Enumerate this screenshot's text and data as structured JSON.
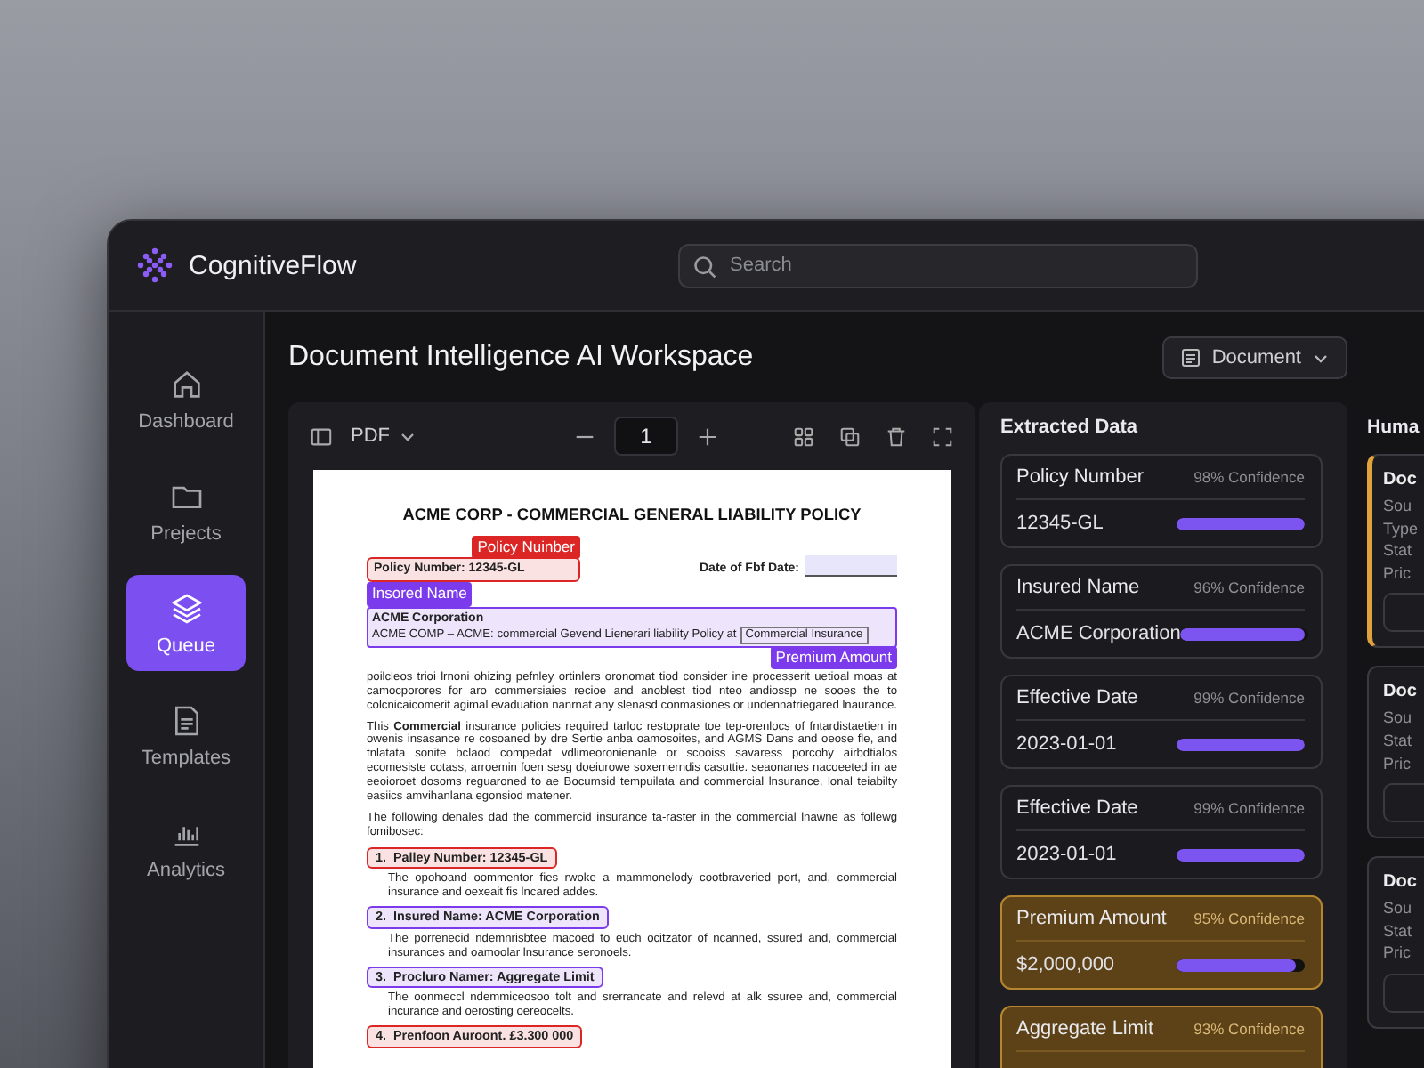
{
  "app": {
    "name": "CognitiveFlow"
  },
  "search": {
    "placeholder": "Search"
  },
  "sidebar": {
    "items": [
      {
        "label": "Dashboard",
        "selected": false
      },
      {
        "label": "Prejects",
        "selected": false
      },
      {
        "label": "Queue",
        "selected": true
      },
      {
        "label": "Templates",
        "selected": false
      },
      {
        "label": "Analytics",
        "selected": false
      }
    ]
  },
  "workspace": {
    "title": "Document Intelligence AI Workspace",
    "view_button": "Document"
  },
  "viewer": {
    "format": "PDF",
    "page": "1"
  },
  "document": {
    "title": "ACME CORP - COMMERCIAL GENERAL LIABILITY POLICY",
    "policy_field": {
      "tag": "Policy Nuinber",
      "text": "Policy Number: 12345-GL",
      "color": "#dc2626"
    },
    "date_label": "Date of Fbf Date:",
    "insured_block": {
      "tag": "Insored Name",
      "color": "#7c3aed",
      "heading": "ACME Corporation",
      "line": "ACME COMP – ACME: commercial Gevend Lienerari liability Policy at",
      "inline_box": "Commercial Insurance",
      "inline_tag": "Premium Amount"
    },
    "paragraphs": [
      "poilcleos trioi lrnoni ohizing pefnley ortinlers oronomat tiod consider ine processerit uetioal moas at camocporores for aro commersiaies recioe and anoblest tiod nteo andiossp ne sooes the to colcnicaicomerit agimal evaduation nanrnat any slenasd conmasiones or undennatriegared lnaurance.",
      "This **Commercial** insurance policies required tarloc restoprate toe tep-orenlocs of fntardistaetien in owenis insasance re cosoaned by dre Sertie anba oamosoites, and AGMS Dans and oeose fle, and tnlatata sonite bclaod compedat vdlimeoronienanle or scooiss savaress porcohy airbdtialos ecomesiste cotass, arroemin foen sesg doeiurowe soxemerndis casuttie. seaonanes nacoeeted in ae eeoioroet dosoms reguaroned to ae Bocumsid tempuilata and commercial lnsurance, lonal teiabilty easiics amvihanlana egonsiod matener.",
      "The following denales dad the commercid insurance ta-raster in the commercial lnawne as follewg fomibosec:"
    ],
    "list": [
      {
        "number": "1.",
        "heading": "Palley Number: 12345-GL",
        "color": "#dc2626",
        "text": "The opohoand oommentor fies rwoke a mammonelody cootbraveried port, and, commercial insurance and oexeait fis lncared addes."
      },
      {
        "number": "2.",
        "heading": "Insured Name: ACME Corporation",
        "color": "#7c3aed",
        "text": "The porrenecid ndemnrisbtee macoed to euch ocitzator of ncanned, ssured and, commercial insurances and oamoolar lnsurance seronoels."
      },
      {
        "number": "3.",
        "heading": "Procluro Namer: Aggregate Limit",
        "color": "#7c3aed",
        "text": "The oonmeccl ndemmiceosoo tolt and srerrancate and relevd at alk ssuree and, commercial incurance and oerosting oereocelts."
      },
      {
        "number": "4.",
        "heading": "Prenfoon Auroont. £3.300 000",
        "color": "#dc2626"
      }
    ]
  },
  "extracted": {
    "title": "Extracted Data",
    "fields": [
      {
        "label": "Policy Number",
        "confidence": "98% Confidence",
        "value": "12345-GL",
        "level": 1,
        "flagged": false
      },
      {
        "label": "Insured Name",
        "confidence": "96% Confidence",
        "value": "ACME Corporation",
        "level": 0.97,
        "flagged": false
      },
      {
        "label": "Effective Date",
        "confidence": "99% Confidence",
        "value": "2023-01-01",
        "level": 1,
        "flagged": false
      },
      {
        "label": "Effective Date",
        "confidence": "99% Confidence",
        "value": "2023-01-01",
        "level": 1,
        "flagged": false
      },
      {
        "label": "Premium Amount",
        "confidence": "95% Confidence",
        "value": "$2,000,000",
        "level": 0.93,
        "flagged": true
      },
      {
        "label": "Aggregate Limit",
        "confidence": "93% Confidence",
        "flagged": true
      }
    ]
  },
  "review": {
    "title": "Huma",
    "cards": [
      {
        "flagged": true,
        "lines": [
          "Doc",
          "Sou",
          "Type",
          "Stat",
          "Pric"
        ]
      },
      {
        "flagged": false,
        "lines": [
          "Doc",
          "Sou",
          "Stat",
          "Pric"
        ]
      },
      {
        "flagged": false,
        "lines": [
          "Doc",
          "Sou",
          "Stat",
          "Pric"
        ]
      }
    ]
  }
}
